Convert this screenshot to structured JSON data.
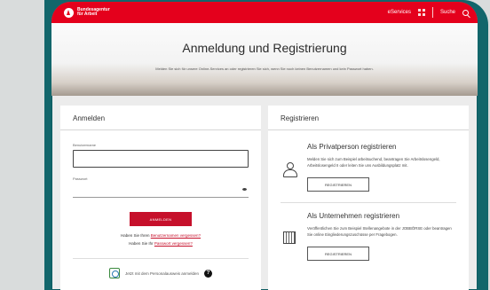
{
  "header": {
    "logo_line1": "Bundesagentur",
    "logo_line2": "für Arbeit",
    "eservices_label": "eServices",
    "search_label": "Suche"
  },
  "hero": {
    "title": "Anmeldung und Registrierung",
    "intro": "Melden Sie sich für unsere Online-Services an oder registrieren Sie sich, wenn Sie noch keinen Benutzernamen und kein Passwort haben."
  },
  "login": {
    "heading": "Anmelden",
    "username_label": "Benutzername",
    "username_value": "",
    "password_label": "Passwort",
    "password_value": "",
    "submit_label": "ANMELDEN",
    "forgot_user_prefix": "Haben Sie Ihren ",
    "forgot_user_link": "Benutzernamen vergessen?",
    "forgot_pw_prefix": "Haben Sie Ihr ",
    "forgot_pw_link": "Passwort vergessen?",
    "id_card_label": "Jetzt mit dem Personalausweis anmelden"
  },
  "register": {
    "heading": "Registrieren",
    "private": {
      "title": "Als Privatperson registrieren",
      "text": "Melden Sie sich zum Beispiel arbeitsuchend, beantragen Sie Arbeitslosengeld, Arbeitslosengeld II oder leiten Sie uns Ausbildungsplatz mit.",
      "button_label": "REGISTRIEREN"
    },
    "company": {
      "title": "Als Unternehmen registrieren",
      "text": "Veröffentlichen Sie zum Beispiel Stellenangebote in der JOBBÖRSE oder beantragen Sie online Eingliederungszuschüsse per Fragebogen.",
      "button_label": "REGISTRIEREN"
    }
  },
  "colors": {
    "brand_red": "#e4001c",
    "button_red": "#c6102b",
    "frame_teal": "#12666b"
  }
}
